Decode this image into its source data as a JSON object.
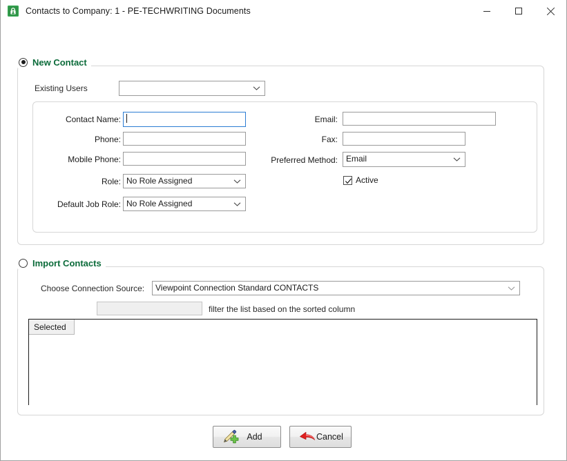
{
  "window": {
    "title": "Contacts to Company: 1 - PE-TECHWRITING Documents",
    "icon": "contacts-app-icon",
    "controls": {
      "minimize": "minimize-button",
      "maximize": "maximize-button",
      "close": "close-button"
    }
  },
  "new_contact": {
    "section_label": "New Contact",
    "selected": true,
    "existing_users": {
      "label": "Existing Users",
      "value": "",
      "placeholder": ""
    },
    "fields": {
      "contact_name": {
        "label": "Contact Name:",
        "value": "",
        "focused": true
      },
      "phone": {
        "label": "Phone:",
        "value": ""
      },
      "mobile_phone": {
        "label": "Mobile Phone:",
        "value": ""
      },
      "role": {
        "label": "Role:",
        "value": "No Role Assigned"
      },
      "default_job_role": {
        "label": "Default Job Role:",
        "value": "No Role Assigned"
      },
      "email": {
        "label": "Email:",
        "value": ""
      },
      "fax": {
        "label": "Fax:",
        "value": ""
      },
      "preferred_method": {
        "label": "Preferred Method:",
        "value": "Email"
      },
      "active": {
        "label": "Active",
        "checked": true
      }
    }
  },
  "import_contacts": {
    "section_label": "Import Contacts",
    "selected": false,
    "connection_source": {
      "label": "Choose Connection Source:",
      "value": "Viewpoint Connection Standard CONTACTS"
    },
    "filter": {
      "value": "",
      "hint": "filter the list based on the sorted column",
      "disabled": true
    },
    "grid": {
      "columns": [
        "Selected"
      ],
      "rows": []
    }
  },
  "footer": {
    "add_label": "Add",
    "add_icon": "pen-add-icon",
    "cancel_label": "Cancel",
    "cancel_icon": "red-undo-arrow-icon"
  },
  "colors": {
    "section_green": "#0b6b3a",
    "focus_blue": "#2b7cd3",
    "cancel_red": "#d7201f",
    "accent_green": "#5bb75b"
  }
}
